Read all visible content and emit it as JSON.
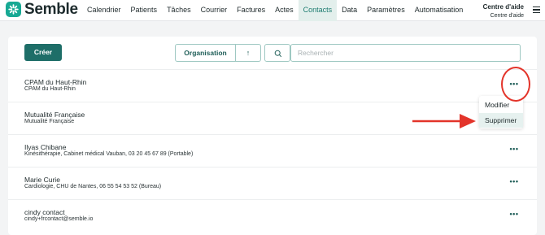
{
  "app": {
    "name": "Semble"
  },
  "nav": {
    "items": [
      "Calendrier",
      "Patients",
      "Tâches",
      "Courrier",
      "Factures",
      "Actes",
      "Contacts",
      "Data",
      "Paramètres",
      "Automatisation"
    ],
    "active": "Contacts"
  },
  "help": {
    "title": "Centre d'aide",
    "subtitle": "Centre d'aide"
  },
  "toolbar": {
    "create_label": "Créer",
    "sort_label": "Organisation",
    "search_placeholder": "Rechercher"
  },
  "contacts": [
    {
      "name": "CPAM du Haut-Rhin",
      "detail": "CPAM du Haut-Rhin"
    },
    {
      "name": "Mutualité Française",
      "detail": "Mutualité Française"
    },
    {
      "name": "Ilyas Chibane",
      "detail": "Kinésithérapie, Cabinet médical Vauban, 03 20 45 67 89 (Portable)"
    },
    {
      "name": "Marie Curie",
      "detail": "Cardiologie, CHU de Nantes, 06 55 54 53 52 (Bureau)"
    },
    {
      "name": "cindy contact",
      "detail": "cindy+frcontact@semble.io"
    }
  ],
  "row_menu": {
    "modify_label": "Modifier",
    "delete_label": "Supprimer"
  },
  "colors": {
    "brand": "#17a994",
    "primary_button": "#1e6e68",
    "annotation": "#e3342a"
  }
}
